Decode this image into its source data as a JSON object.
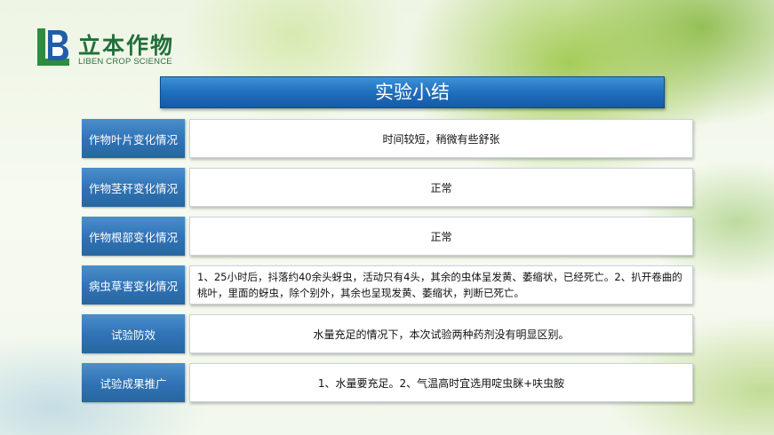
{
  "logo": {
    "mark_letters": "LB",
    "name_cn": "立本作物",
    "name_en": "LIBEN CROP SCIENCE"
  },
  "title": "实验小结",
  "rows": [
    {
      "label": "作物叶片变化情况",
      "value": "时间较短，稍微有些舒张"
    },
    {
      "label": "作物茎秆变化情况",
      "value": "正常"
    },
    {
      "label": "作物根部变化情况",
      "value": "正常"
    },
    {
      "label": "病虫草害变化情况",
      "value": "1、25小时后，抖落约40余头蚜虫，活动只有4头，其余的虫体呈发黄、萎缩状，已经死亡。2、扒开卷曲的桃叶，里面的蚜虫，除个别外，其余也呈现发黄、萎缩状，判断已死亡。"
    },
    {
      "label": "试验防效",
      "value": "水量充足的情况下，本次试验两种药剂没有明显区别。"
    },
    {
      "label": "试验成果推广",
      "value": "1、水量要充足。2、气温高时宜选用啶虫脒+呋虫胺"
    }
  ],
  "colors": {
    "label_blue": "#2f72b5",
    "title_blue": "#1f6fbf",
    "logo_green": "#1f6f3a"
  }
}
